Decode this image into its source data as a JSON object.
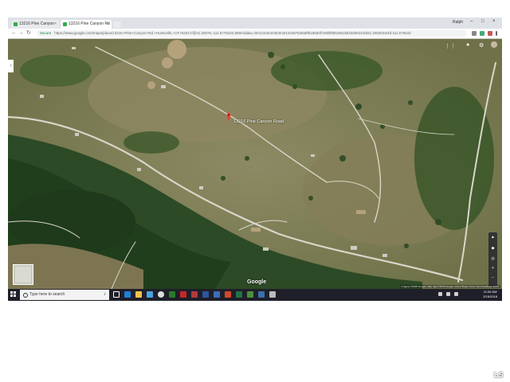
{
  "browser": {
    "tabs": [
      {
        "label": "13216 Pine Canyon Rd"
      },
      {
        "label": "13216 Pine Canyon Rd"
      }
    ],
    "profile_label": "Ralph",
    "secure_label": "Secure",
    "url": "https://www.google.com/maps/place/13216+Pine+Canyon+Rd,+Huntsville,+UT+84317/@41.20076,-111.6775432,980m/data=!3m1!1e3!4m5!3m4!1s0x87530a8f5186d0f:0x6bf9b5c80c5b33d!8m2!3d41.2054034!4d-111.679442"
  },
  "map": {
    "pin_label": "13216 Pine Canyon Road",
    "logo_text": "Google",
    "attribution": "Imagery ©2018 Google, Map data ©2018 Google   United States   Terms   Send feedback   200 ft",
    "zoom_in_label": "+",
    "zoom_out_label": "−"
  },
  "taskbar": {
    "search_placeholder": "Type here to search",
    "time": "11:06 AM",
    "date": "2/16/2018"
  },
  "corner_mark": "LS",
  "colors": {
    "taskbar": "#1f1f2a",
    "tab_strip": "#dee1e6",
    "pin": "#ea4335",
    "secure": "#188038"
  }
}
